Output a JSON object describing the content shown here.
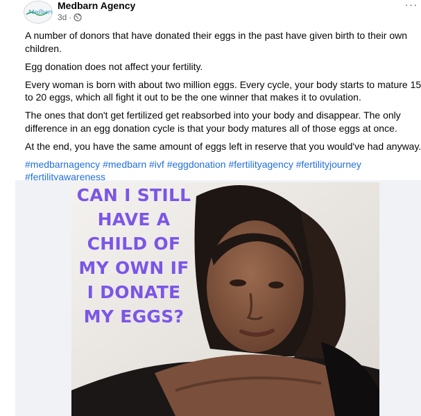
{
  "post": {
    "page_name": "Medbarn Agency",
    "avatar_logo_text": "Medbarn",
    "timestamp": "3d",
    "separator": "·",
    "audience_icon": "globe-icon",
    "more_icon": "more-horizontal-icon",
    "more_label": "···",
    "paragraphs": [
      "A number of donors that have donated their eggs in the past have given birth to their own children.",
      "Egg donation does not affect your fertility.",
      "Every woman is born with about two million eggs. Every cycle, your body starts to mature 15 to 20 eggs, which all fight it out to be the one winner that makes it to ovulation.",
      "The ones that don't get fertilized get reabsorbed into your body and disappear. The only difference in an egg donation cycle is that your body matures all of those eggs at once.",
      "At the end, you have the same amount of eggs left in reserve that you would've had anyway."
    ],
    "hashtags": [
      "#medbarnagency",
      "#medbarn",
      "#ivf",
      "#eggdonation",
      "#fertilityagency",
      "#fertilityjourney",
      "#fertilityawareness"
    ]
  },
  "image": {
    "overlay_lines": [
      "CAN I STILL",
      "HAVE A",
      "CHILD OF",
      "MY OWN IF",
      "I DONATE",
      "MY EGGS?"
    ]
  },
  "colors": {
    "link": "#216fdb",
    "overlay_text": "#7b56e6",
    "secondary_text": "#65676b"
  }
}
